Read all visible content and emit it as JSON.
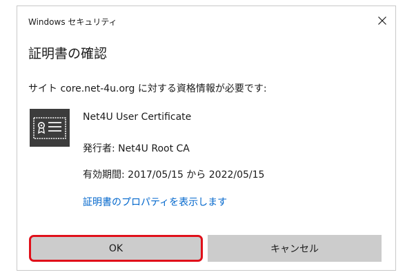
{
  "dialog": {
    "app_title": "Windows セキュリティ",
    "heading": "証明書の確認",
    "prompt": "サイト core.net-4u.org に対する資格情報が必要です:",
    "close_icon": "close-icon"
  },
  "certificate": {
    "icon": "certificate-icon",
    "name": "Net4U User Certificate",
    "issuer": "発行者: Net4U Root CA",
    "validity": "有効期間: 2017/05/15 から 2022/05/15",
    "properties_link": "証明書のプロパティを表示します"
  },
  "buttons": {
    "ok_label": "OK",
    "cancel_label": "キャンセル"
  },
  "colors": {
    "link": "#0066cc",
    "highlight_outline": "#e0101a",
    "button_bg": "#cccccc",
    "icon_dark": "#3c3c3c"
  }
}
